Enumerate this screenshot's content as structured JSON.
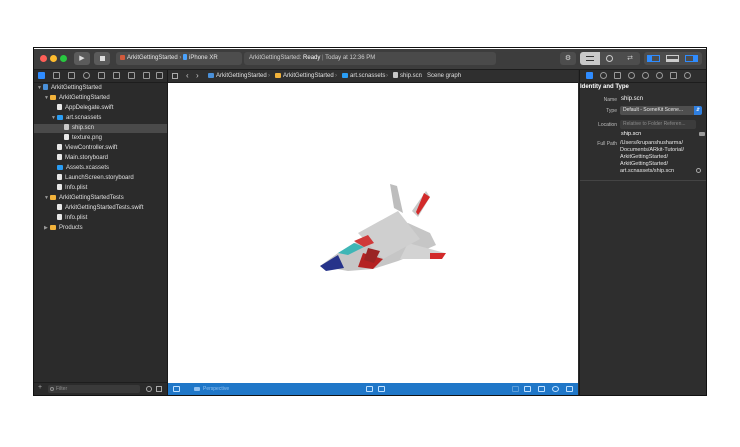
{
  "toolbar": {
    "scheme_project": "ArkitGettingStarted",
    "scheme_device": "iPhone XR",
    "status_project": "ArkitGettingStarted:",
    "status_state": "Ready",
    "status_time": "Today at 12:36 PM"
  },
  "navigator": {
    "items": [
      {
        "label": "ArkitGettingStarted",
        "kind": "project"
      },
      {
        "label": "ArkitGettingStarted",
        "kind": "folder"
      },
      {
        "label": "AppDelegate.swift",
        "kind": "file"
      },
      {
        "label": "art.scnassets",
        "kind": "bluefolder"
      },
      {
        "label": "ship.scn",
        "kind": "scn"
      },
      {
        "label": "texture.png",
        "kind": "file"
      },
      {
        "label": "ViewController.swift",
        "kind": "file"
      },
      {
        "label": "Main.storyboard",
        "kind": "file"
      },
      {
        "label": "Assets.xcassets",
        "kind": "bluefolder"
      },
      {
        "label": "LaunchScreen.storyboard",
        "kind": "file"
      },
      {
        "label": "Info.plist",
        "kind": "file"
      },
      {
        "label": "ArkitGettingStartedTests",
        "kind": "folder"
      },
      {
        "label": "ArkitGettingStartedTests.swift",
        "kind": "file"
      },
      {
        "label": "Info.plist",
        "kind": "file"
      },
      {
        "label": "Products",
        "kind": "folder"
      }
    ],
    "filter_placeholder": "Filter"
  },
  "jumpbar": {
    "crumbs": [
      "ArkitGettingStarted",
      "ArkitGettingStarted",
      "art.scnassets",
      "ship.scn",
      "Scene graph"
    ]
  },
  "scene_bar": {
    "camera_label": "Perspective"
  },
  "inspector": {
    "section_title": "Identity and Type",
    "name_label": "Name",
    "name_value": "ship.scn",
    "type_label": "Type",
    "type_value": "Default - SceneKit Scene...",
    "location_label": "Location",
    "location_value": "Relative to Folder Referen...",
    "location_file": "ship.scn",
    "fullpath_label": "Full Path",
    "fullpath_lines": [
      "/Users/krupanshusharma/",
      "Documents/ARkit-Tutorial/",
      "ArkitGettingStarted/",
      "ArkitGettingStarted/",
      "art.scnassets/ship.scn"
    ]
  },
  "colors": {
    "accent": "#2f8cff",
    "scene_bar": "#1f77c8",
    "folder": "#f2b23a"
  }
}
